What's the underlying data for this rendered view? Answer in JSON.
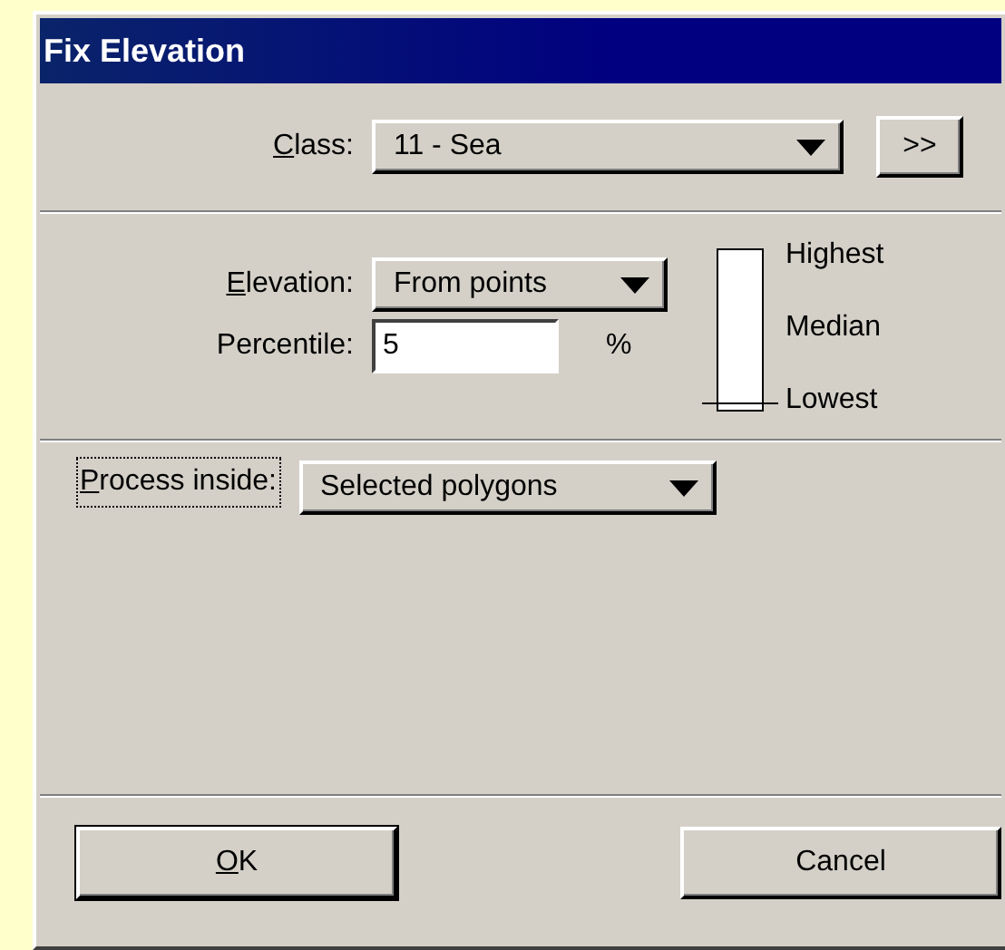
{
  "window": {
    "title": "Fix Elevation"
  },
  "class_row": {
    "label": "Class:",
    "mnemonic": true,
    "value": "11 - Sea",
    "more_button": ">>"
  },
  "elevation_row": {
    "label": "Elevation:",
    "mnemonic": true,
    "value": "From points"
  },
  "percentile_row": {
    "label": "Percentile:",
    "mnemonic": false,
    "value": "5",
    "unit": "%"
  },
  "range_meter": {
    "level": 0.05,
    "labels": [
      "Highest",
      "Median",
      "Lowest"
    ]
  },
  "process_row": {
    "label": "Process inside:",
    "mnemonic": true,
    "focused": true,
    "value": "Selected polygons"
  },
  "buttons": [
    {
      "label": "OK",
      "mnemonic": true,
      "default": true
    },
    {
      "label": "Cancel",
      "mnemonic": false,
      "default": false
    }
  ]
}
